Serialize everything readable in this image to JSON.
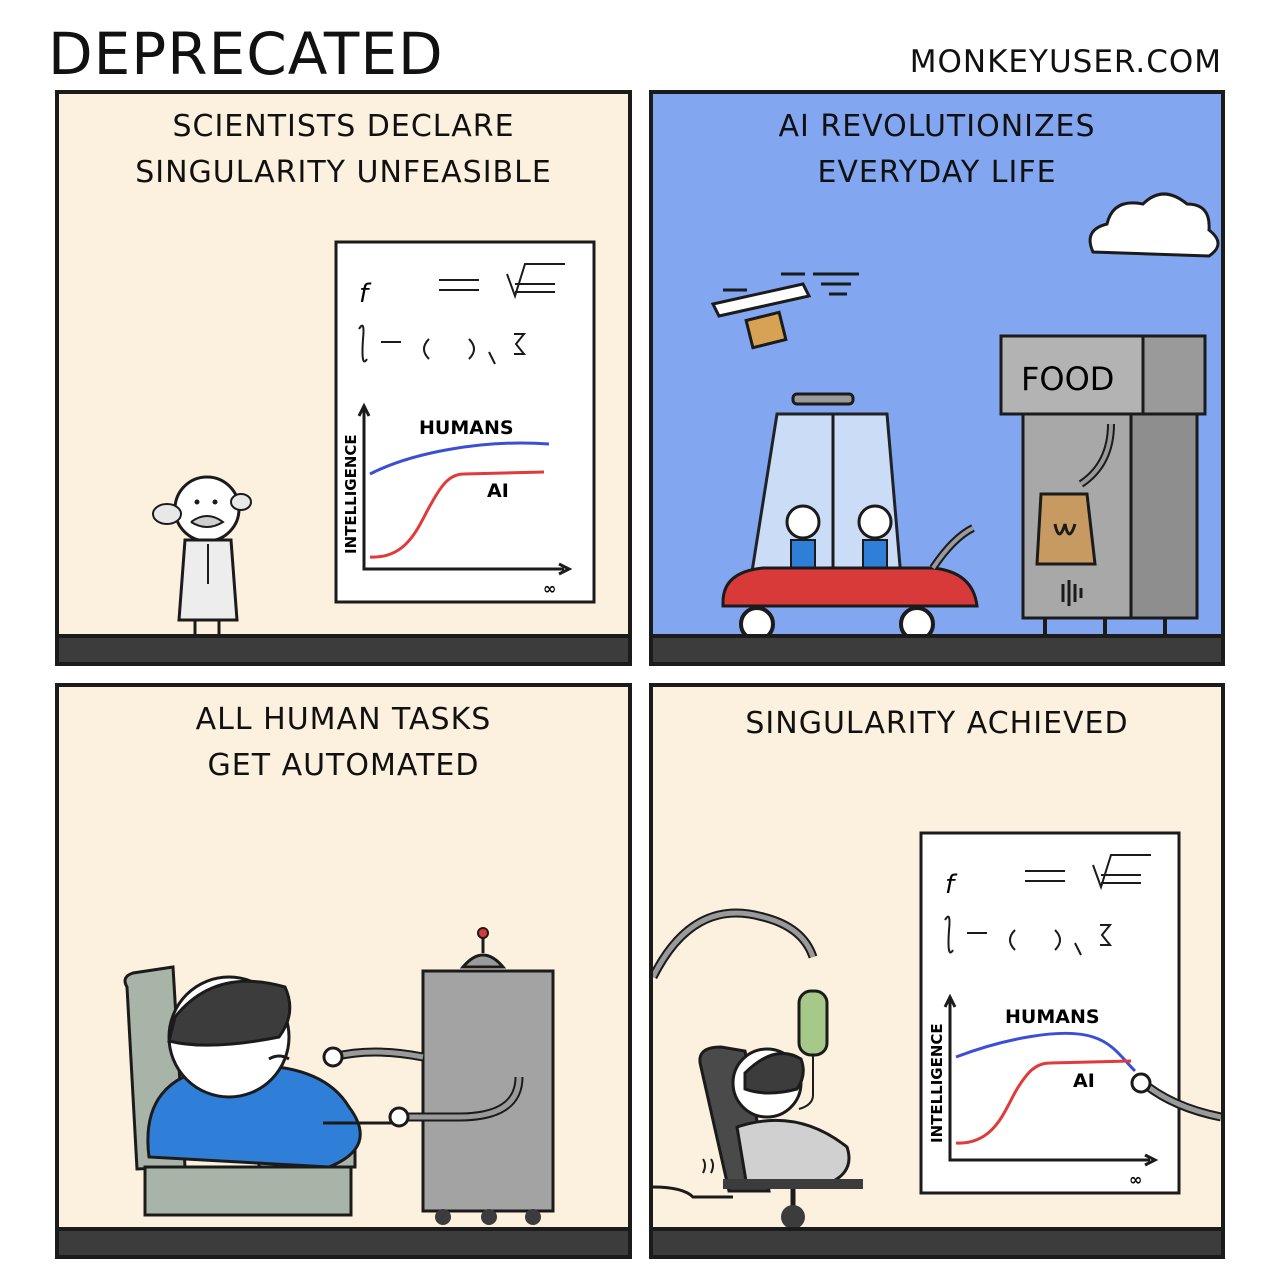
{
  "header": {
    "title": "DEPRECATED",
    "site": "MONKEYUSER.COM"
  },
  "panels": [
    {
      "caption_line1": "SCIENTISTS  DECLARE",
      "caption_line2": "SINGULARITY  UNFEASIBLE",
      "chart": {
        "y_label": "INTELLIGENCE",
        "x_label": "∞",
        "series_top": "HUMANS",
        "series_bottom": "AI"
      }
    },
    {
      "caption_line1": "AI  REVOLUTIONIZES",
      "caption_line2": "EVERYDAY  LIFE",
      "sign": "FOOD"
    },
    {
      "caption_line1": "ALL  HUMAN  TASKS",
      "caption_line2": "GET  AUTOMATED"
    },
    {
      "caption_line1": "SINGULARITY  ACHIEVED",
      "chart": {
        "y_label": "INTELLIGENCE",
        "x_label": "∞",
        "series_top": "HUMANS",
        "series_bottom": "AI"
      }
    }
  ],
  "colors": {
    "humans_line": "#3b4fd6",
    "ai_line": "#e03a3a",
    "sky": "#83a6f1",
    "paper": "#fcf1df",
    "car": "#d83a3a",
    "blanket": "#2f7fd8"
  }
}
